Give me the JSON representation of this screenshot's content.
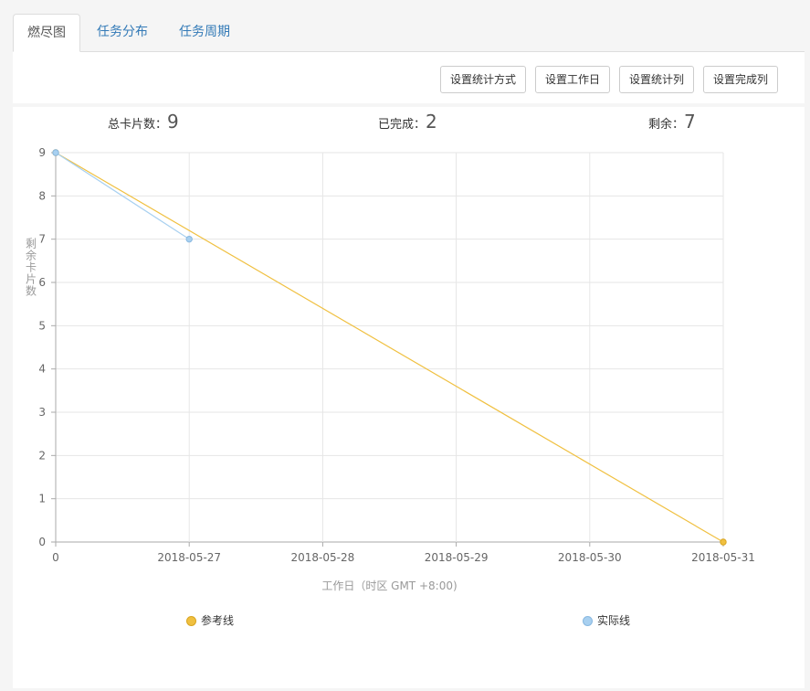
{
  "tabs": [
    {
      "label": "燃尽图",
      "active": true
    },
    {
      "label": "任务分布",
      "active": false
    },
    {
      "label": "任务周期",
      "active": false
    }
  ],
  "toolbar": {
    "buttons": [
      "设置统计方式",
      "设置工作日",
      "设置统计列",
      "设置完成列"
    ]
  },
  "summary": {
    "total_label": "总卡片数：",
    "total_value": "9",
    "done_label": "已完成：",
    "done_value": "2",
    "remaining_label": "剩余：",
    "remaining_value": "7"
  },
  "colors": {
    "reference": "#f0c040",
    "actual": "#a8d0f0",
    "reference_border": "#d9a520",
    "actual_border": "#88b8e0"
  },
  "chart_data": {
    "type": "line",
    "categories": [
      "0",
      "2018-05-27",
      "2018-05-28",
      "2018-05-29",
      "2018-05-30",
      "2018-05-31"
    ],
    "series": [
      {
        "name": "参考线",
        "values": [
          9,
          null,
          null,
          null,
          null,
          0
        ]
      },
      {
        "name": "实际线",
        "values": [
          9,
          7,
          null,
          null,
          null,
          null
        ]
      }
    ],
    "xlabel": "工作日（时区 GMT +8:00)",
    "ylabel": "剩余卡片数",
    "ylim": [
      0,
      9
    ],
    "yticks": [
      0,
      1,
      2,
      3,
      4,
      5,
      6,
      7,
      8,
      9
    ],
    "grid": true,
    "legend_position": "bottom"
  }
}
